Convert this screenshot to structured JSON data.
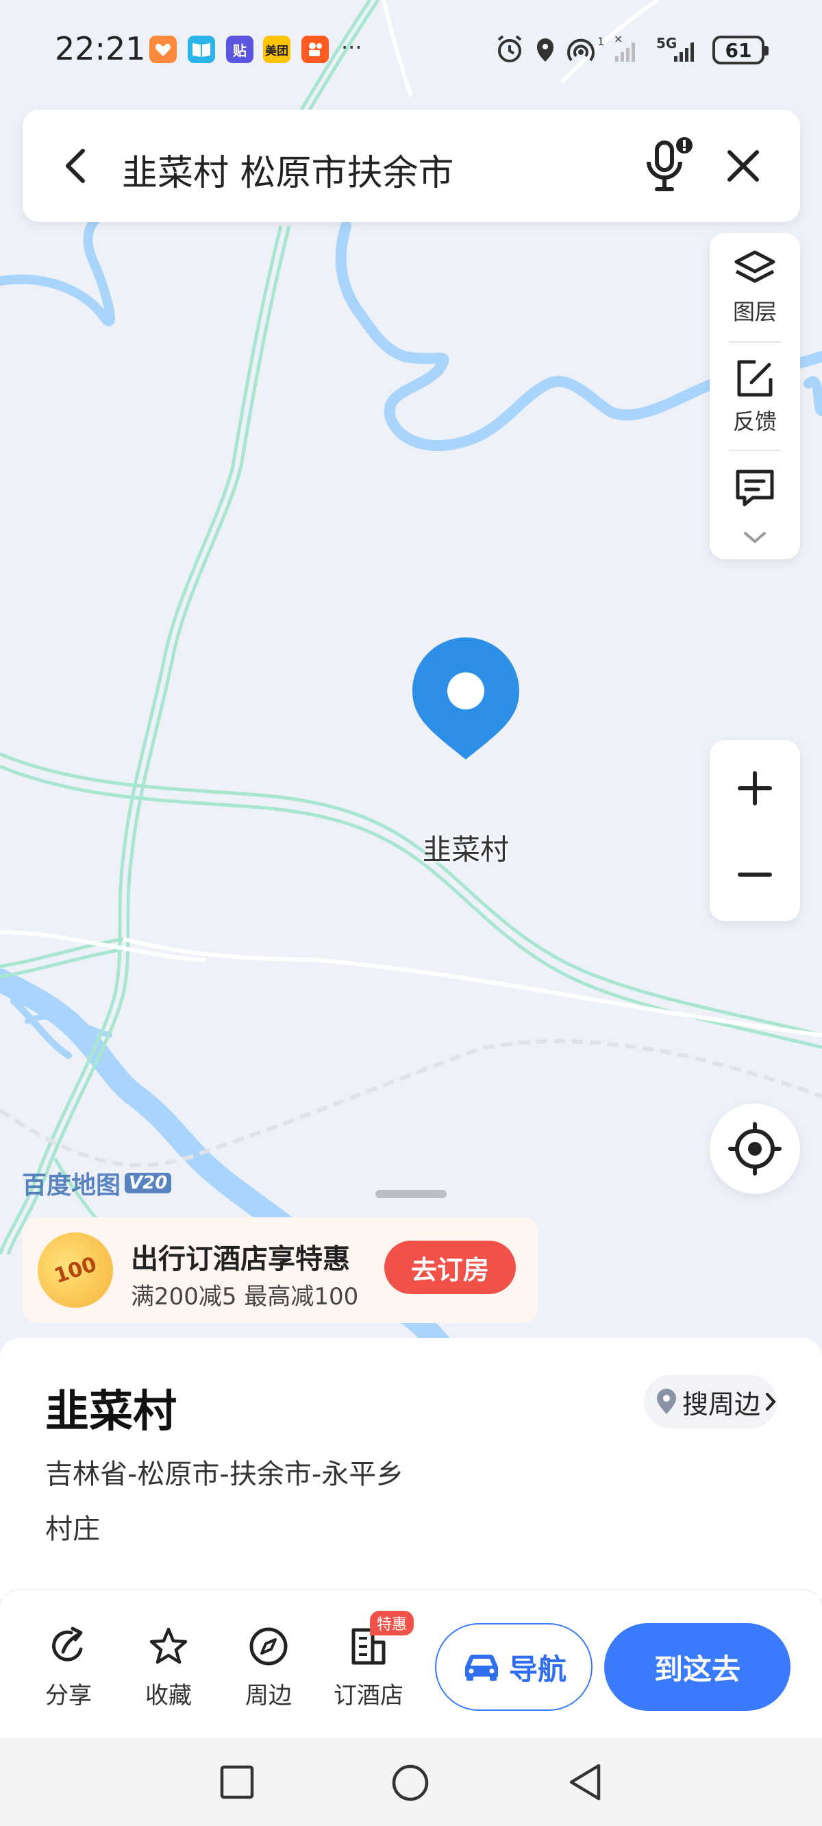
{
  "status_bar": {
    "time": "22:21",
    "apps": [
      {
        "name": "taobao-app-icon",
        "label": "",
        "color": "#ff8a3d"
      },
      {
        "name": "reader-app-icon",
        "label": "",
        "color": "#2bb4e8"
      },
      {
        "name": "tieba-app-icon",
        "label": "贴",
        "color": "#5a56e0"
      },
      {
        "name": "meituan-app-icon",
        "label": "美团",
        "color": "#ffc400"
      },
      {
        "name": "kuaishou-app-icon",
        "label": "",
        "color": "#ff5a1f"
      }
    ],
    "more": "···",
    "network": "5G",
    "battery": "61"
  },
  "search": {
    "query": "韭菜村 松原市扶余市"
  },
  "side_tools": {
    "layers_label": "图层",
    "feedback_label": "反馈"
  },
  "map": {
    "marker_label": "韭菜村",
    "logo_text": "百度地图",
    "logo_version": "V20"
  },
  "promo": {
    "badge": "100",
    "title": "出行订酒店享特惠",
    "subtitle": "满200减5 最高减100",
    "button": "去订房"
  },
  "place": {
    "name": "韭菜村",
    "nearby_label": "搜周边",
    "address": "吉林省-松原市-扶余市-永平乡",
    "category": "村庄"
  },
  "actions": {
    "share": "分享",
    "favorite": "收藏",
    "nearby": "周边",
    "hotel": "订酒店",
    "hotel_tag": "特惠",
    "navigate": "导航",
    "go_here": "到这去"
  },
  "colors": {
    "accent": "#3a7bfd",
    "marker": "#2e8fe6",
    "promo_button": "#f0524a",
    "river": "#a9d4fb",
    "road": "#a8e6cf"
  }
}
